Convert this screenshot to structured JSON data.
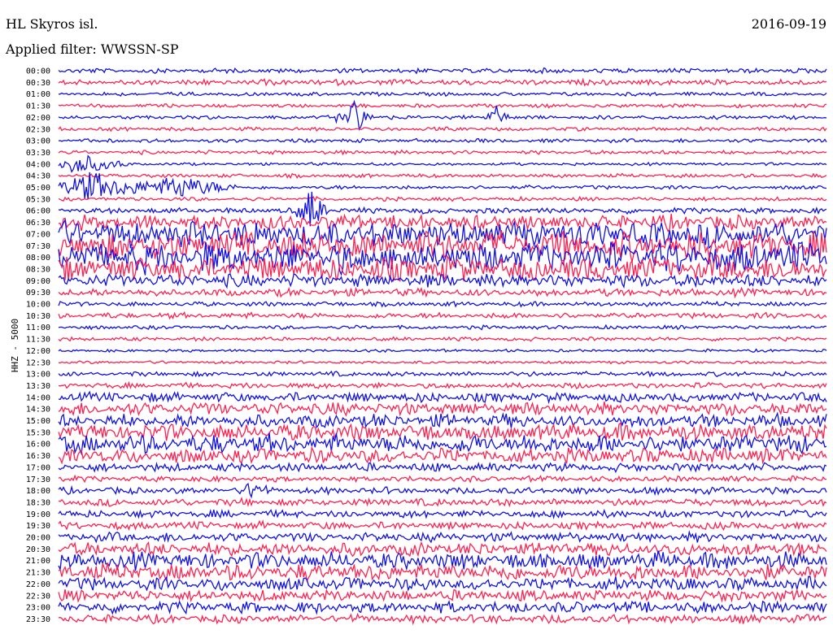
{
  "header": {
    "station": "HL Skyros isl.",
    "date": "2016-09-19",
    "filter": "Applied filter: WWSSN-SP"
  },
  "chart_data": {
    "type": "line",
    "title": "HL Skyros isl.",
    "subtitle": "Applied filter: WWSSN-SP",
    "ylabel": "HHZ - 5000",
    "xlabel": "",
    "grid": false,
    "colors": [
      "#1010e0",
      "#ff2050"
    ],
    "rows": [
      {
        "label": "00:00",
        "level": 0.25
      },
      {
        "label": "00:30",
        "level": 0.3
      },
      {
        "label": "01:00",
        "level": 0.2
      },
      {
        "label": "01:30",
        "level": 0.2
      },
      {
        "label": "02:00",
        "level": 0.2
      },
      {
        "label": "02:30",
        "level": 0.2
      },
      {
        "label": "03:00",
        "level": 0.2
      },
      {
        "label": "03:30",
        "level": 0.2
      },
      {
        "label": "04:00",
        "level": 0.15
      },
      {
        "label": "04:30",
        "level": 0.2
      },
      {
        "label": "05:00",
        "level": 0.2
      },
      {
        "label": "05:30",
        "level": 0.2
      },
      {
        "label": "06:00",
        "level": 0.3
      },
      {
        "label": "06:30",
        "level": 0.8
      },
      {
        "label": "07:00",
        "level": 1.4
      },
      {
        "label": "07:30",
        "level": 1.5
      },
      {
        "label": "08:00",
        "level": 1.6
      },
      {
        "label": "08:30",
        "level": 1.3
      },
      {
        "label": "09:00",
        "level": 0.7
      },
      {
        "label": "09:30",
        "level": 0.4
      },
      {
        "label": "10:00",
        "level": 0.25
      },
      {
        "label": "10:30",
        "level": 0.3
      },
      {
        "label": "11:00",
        "level": 0.2
      },
      {
        "label": "11:30",
        "level": 0.2
      },
      {
        "label": "12:00",
        "level": 0.15
      },
      {
        "label": "12:30",
        "level": 0.15
      },
      {
        "label": "13:00",
        "level": 0.25
      },
      {
        "label": "13:30",
        "level": 0.3
      },
      {
        "label": "14:00",
        "level": 0.5
      },
      {
        "label": "14:30",
        "level": 0.7
      },
      {
        "label": "15:00",
        "level": 0.7
      },
      {
        "label": "15:30",
        "level": 0.9
      },
      {
        "label": "16:00",
        "level": 1.0
      },
      {
        "label": "16:30",
        "level": 0.8
      },
      {
        "label": "17:00",
        "level": 0.45
      },
      {
        "label": "17:30",
        "level": 0.3
      },
      {
        "label": "18:00",
        "level": 0.35
      },
      {
        "label": "18:30",
        "level": 0.4
      },
      {
        "label": "19:00",
        "level": 0.4
      },
      {
        "label": "19:30",
        "level": 0.4
      },
      {
        "label": "20:00",
        "level": 0.5
      },
      {
        "label": "20:30",
        "level": 0.7
      },
      {
        "label": "21:00",
        "level": 0.9
      },
      {
        "label": "21:30",
        "level": 0.9
      },
      {
        "label": "22:00",
        "level": 0.7
      },
      {
        "label": "22:30",
        "level": 0.6
      },
      {
        "label": "23:00",
        "level": 0.6
      },
      {
        "label": "23:30",
        "level": 0.45
      }
    ],
    "events": [
      {
        "row": 4,
        "at": 0.385,
        "amp": 1.6,
        "width": 0.012
      },
      {
        "row": 4,
        "at": 0.57,
        "amp": 1.0,
        "width": 0.008
      },
      {
        "row": 8,
        "at": 0.03,
        "amp": 0.9,
        "width": 0.03
      },
      {
        "row": 10,
        "at": 0.045,
        "amp": 1.4,
        "width": 0.03
      },
      {
        "row": 10,
        "at": 0.155,
        "amp": 1.0,
        "width": 0.04
      },
      {
        "row": 12,
        "at": 0.33,
        "amp": 2.2,
        "width": 0.01
      },
      {
        "row": 36,
        "at": 0.255,
        "amp": 0.8,
        "width": 0.01
      }
    ]
  }
}
